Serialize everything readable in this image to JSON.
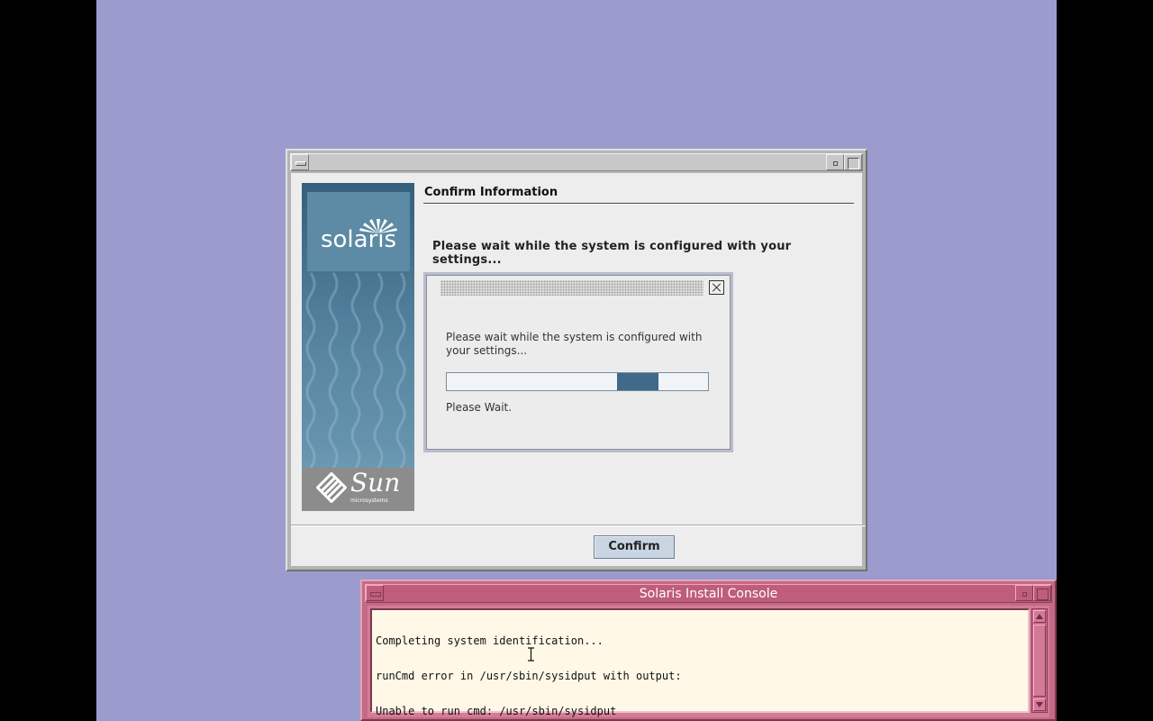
{
  "installer": {
    "section_title": "Confirm Information",
    "status_message": "Please wait while the system is configured with your settings...",
    "brand": {
      "product": "solaris",
      "company": "Sun",
      "company_sub": "microsystems"
    },
    "confirm_label": "Confirm"
  },
  "progress_dialog": {
    "message": "Please wait while the system is configured with your settings...",
    "wait_label": "Please Wait.",
    "indicator": {
      "start": 0.65,
      "end": 0.81
    }
  },
  "console": {
    "title": "Solaris Install Console",
    "lines": [
      "Completing system identification...",
      "runCmd error in /usr/sbin/sysidput with output:",
      "Unable to run cmd: /usr/sbin/sysidput"
    ]
  },
  "colors": {
    "desktop": "#9b9ccd",
    "console_titlebar": "#bf5d7b",
    "console_background": "#fff8e7",
    "progress_fill": "#3f6a8a"
  }
}
